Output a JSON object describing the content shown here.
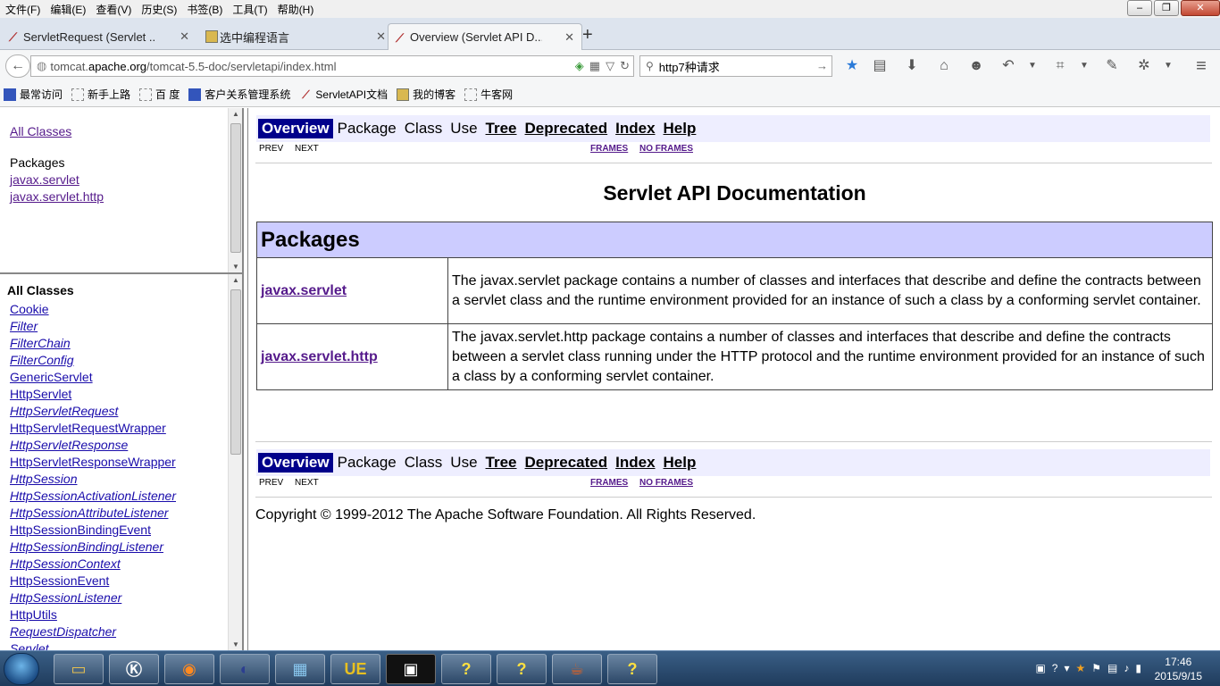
{
  "menubar": {
    "items": [
      "文件(F)",
      "编辑(E)",
      "查看(V)",
      "历史(S)",
      "书签(B)",
      "工具(T)",
      "帮助(H)"
    ]
  },
  "window_controls": {
    "minimize": "–",
    "restore": "❐",
    "close": "✕"
  },
  "tabs": [
    {
      "label": "ServletRequest (Servlet ...",
      "icon": "feather-icon",
      "active": false
    },
    {
      "label": "选中编程语言",
      "icon": "image-icon",
      "active": false
    },
    {
      "label": "Overview (Servlet API D...",
      "icon": "feather-icon",
      "active": true
    }
  ],
  "new_tab": "+",
  "navbar": {
    "url_prefix": "tomcat.",
    "url_domain": "apache.org",
    "url_path": "/tomcat-5.5-doc/servletapi/index.html",
    "search_value": "http7种请求"
  },
  "bookmarks": [
    {
      "label": "最常访问",
      "icon": "blue-icon"
    },
    {
      "label": "新手上路",
      "icon": "folder-icon"
    },
    {
      "label": "百 度",
      "icon": "folder-icon"
    },
    {
      "label": "客户关系管理系统",
      "icon": "blue-icon"
    },
    {
      "label": "ServletAPI文档",
      "icon": "feather-icon"
    },
    {
      "label": "我的博客",
      "icon": "image-icon"
    },
    {
      "label": "牛客网",
      "icon": "folder-icon"
    }
  ],
  "packages_frame": {
    "all_classes": "All Classes",
    "heading": "Packages",
    "packages": [
      "javax.servlet",
      "javax.servlet.http"
    ]
  },
  "classes_frame": {
    "heading": "All Classes",
    "classes": [
      {
        "name": "Cookie",
        "italic": false
      },
      {
        "name": "Filter",
        "italic": true
      },
      {
        "name": "FilterChain",
        "italic": true
      },
      {
        "name": "FilterConfig",
        "italic": true
      },
      {
        "name": "GenericServlet",
        "italic": false
      },
      {
        "name": "HttpServlet",
        "italic": false
      },
      {
        "name": "HttpServletRequest",
        "italic": true
      },
      {
        "name": "HttpServletRequestWrapper",
        "italic": false
      },
      {
        "name": "HttpServletResponse",
        "italic": true
      },
      {
        "name": "HttpServletResponseWrapper",
        "italic": false
      },
      {
        "name": "HttpSession",
        "italic": true
      },
      {
        "name": "HttpSessionActivationListener",
        "italic": true
      },
      {
        "name": "HttpSessionAttributeListener",
        "italic": true
      },
      {
        "name": "HttpSessionBindingEvent",
        "italic": false
      },
      {
        "name": "HttpSessionBindingListener",
        "italic": true
      },
      {
        "name": "HttpSessionContext",
        "italic": true
      },
      {
        "name": "HttpSessionEvent",
        "italic": false
      },
      {
        "name": "HttpSessionListener",
        "italic": true
      },
      {
        "name": "HttpUtils",
        "italic": false
      },
      {
        "name": "RequestDispatcher",
        "italic": true
      },
      {
        "name": "Servlet",
        "italic": true
      }
    ]
  },
  "main": {
    "nav": {
      "overview": "Overview",
      "package": "Package",
      "class": "Class",
      "use": "Use",
      "tree": "Tree",
      "deprecated": "Deprecated",
      "index": "Index",
      "help": "Help",
      "prev": "PREV",
      "next": "NEXT",
      "frames": "FRAMES",
      "no_frames": "NO FRAMES"
    },
    "title": "Servlet API Documentation",
    "table": {
      "header": "Packages",
      "rows": [
        {
          "name": "javax.servlet",
          "description": "The javax.servlet package contains a number of classes and interfaces that describe and define the contracts between a servlet class and the runtime environment provided for an instance of such a class by a conforming servlet container."
        },
        {
          "name": "javax.servlet.http",
          "description": "The javax.servlet.http package contains a number of classes and interfaces that describe and define the contracts between a servlet class running under the HTTP protocol and the runtime environment provided for an instance of such a class by a conforming servlet container."
        }
      ]
    },
    "copyright": "Copyright © 1999-2012 The Apache Software Foundation. All Rights Reserved."
  },
  "taskbar": {
    "time": "17:46",
    "date": "2015/9/15"
  },
  "colors": {
    "nav_bg": "#eeeeff",
    "nav_current": "#00008b",
    "table_header": "#ccccff",
    "link": "#551a8b"
  }
}
